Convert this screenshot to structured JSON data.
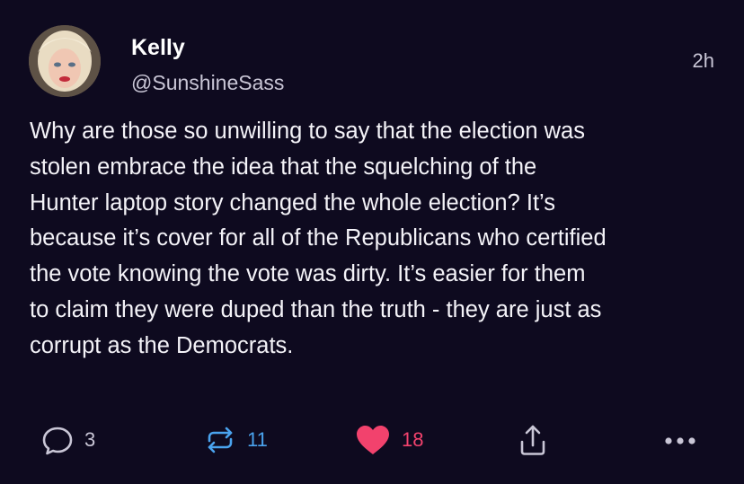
{
  "author": {
    "display_name": "Kelly",
    "handle": "@SunshineSass"
  },
  "post": {
    "time_ago": "2h",
    "text": "Why are those so unwilling to say that the election was\nstolen embrace the idea that the squelching of the\nHunter laptop story changed the whole election? It’s\nbecause it’s cover for all of the Republicans who certified\nthe vote knowing the vote was dirty. It’s easier for them\nto claim they were duped than the truth - they are just as\ncorrupt as the Democrats."
  },
  "actions": {
    "reply": {
      "icon": "reply-bubble-icon",
      "count": "3"
    },
    "repost": {
      "icon": "repost-arrows-icon",
      "count": "11",
      "color": "#4aa3ee"
    },
    "like": {
      "icon": "heart-icon",
      "count": "18",
      "color": "#f2426d"
    },
    "share": {
      "icon": "share-icon"
    },
    "more": {
      "icon": "more-dots-icon"
    }
  },
  "colors": {
    "background": "#0e0a1f",
    "text": "#ffffff",
    "muted": "#c9c6d6"
  }
}
